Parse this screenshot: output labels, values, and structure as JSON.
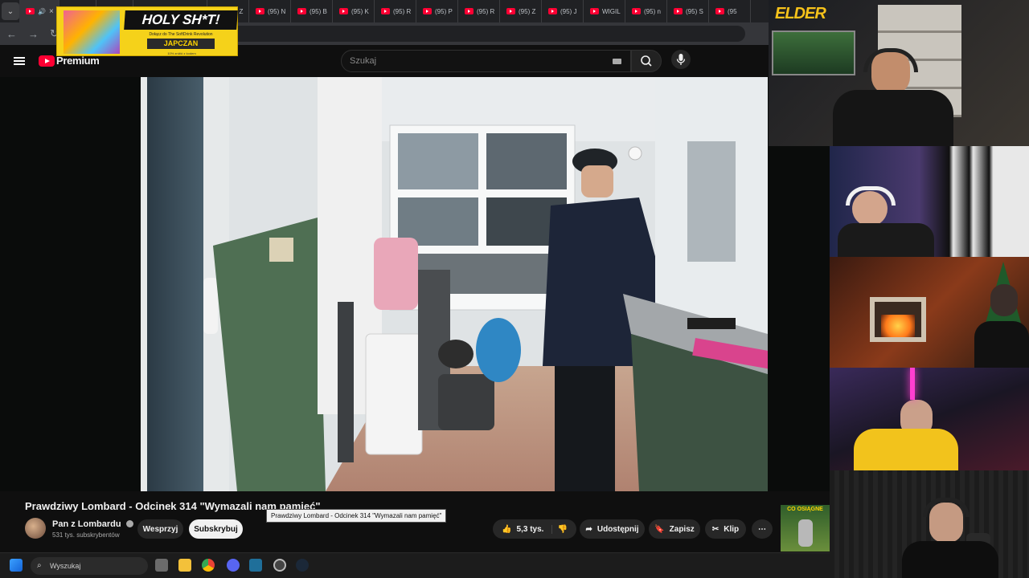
{
  "browser": {
    "tab_labels": [
      "(95) Z",
      "(95) N",
      "(95) B",
      "(95) K",
      "(95) R",
      "(95) P",
      "(95) R",
      "(95) Z",
      "(95) J",
      "WIGIL",
      "(95) n",
      "(95) S",
      "(95"
    ]
  },
  "ad": {
    "title": "HOLY SH*T!",
    "subtitle": "Dołącz do The SoftDrink Revolution",
    "brand": "JAPCZAN",
    "fineprint": "10% zniżki z kodem"
  },
  "webcam_overlay": {
    "logo_text": "ELDER"
  },
  "youtube": {
    "logo_label": "Premium",
    "search_placeholder": "Szukaj"
  },
  "video": {
    "title": "Prawdziwy Lombard - Odcinek 314 \"Wymazali nam pamięć\"",
    "tooltip": "Prawdziwy Lombard - Odcinek 314 \"Wymazali nam pamięć\""
  },
  "channel": {
    "name": "Pan z Lombardu",
    "subscribers": "531 tys. subskrybentów",
    "support_label": "Wesprzyj",
    "subscribe_label": "Subskrybuj"
  },
  "actions": {
    "likes": "5,3 tys.",
    "share": "Udostępnij",
    "save": "Zapisz",
    "clip": "Klip"
  },
  "side_thumbnail": {
    "caption": "CO OSIĄGNE"
  },
  "taskbar": {
    "search_placeholder": "Wyszukaj"
  }
}
